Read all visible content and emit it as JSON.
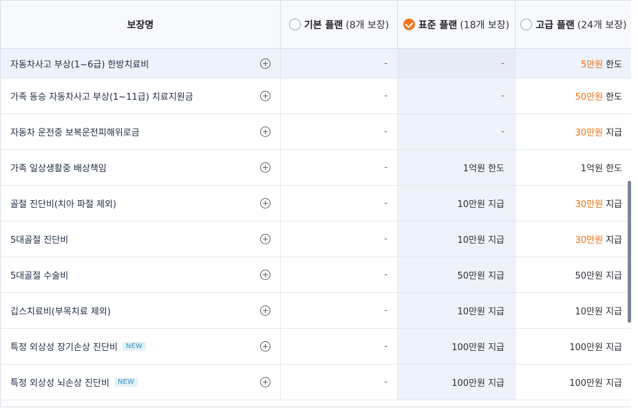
{
  "header": {
    "name_col": "보장명",
    "plans": [
      {
        "title": "기본 플랜",
        "count": "(8개 보장)",
        "selected": false
      },
      {
        "title": "표준 플랜",
        "count": "(18개 보장)",
        "selected": true
      },
      {
        "title": "고급 플랜",
        "count": "(24개 보장)",
        "selected": false
      }
    ]
  },
  "colors": {
    "accent": "#f2771f",
    "highlight_text": "#f06f12",
    "std_column_bg": "#eef2fa"
  },
  "rows": [
    {
      "name": "자동차사고 부상(1~6급) 한방치료비",
      "basic": "-",
      "std": "-",
      "prem_highlight": "5만원",
      "prem_rest": "한도",
      "prem_plain": ""
    },
    {
      "name": "가족 동승 자동차사고 부상(1~11급) 치료지원금",
      "basic": "-",
      "std": "-",
      "prem_highlight": "50만원",
      "prem_rest": "한도",
      "prem_plain": ""
    },
    {
      "name": "자동차 운전중 보복운전피해위로금",
      "basic": "-",
      "std": "-",
      "prem_highlight": "30만원",
      "prem_rest": "지급",
      "prem_plain": ""
    },
    {
      "name": "가족 일상생활중 배상책임",
      "basic": "-",
      "std": "1억원 한도",
      "prem_highlight": "",
      "prem_rest": "",
      "prem_plain": "1억원 한도"
    },
    {
      "name": "골절 진단비(치아 파절 제외)",
      "basic": "-",
      "std": "10만원 지급",
      "prem_highlight": "30만원",
      "prem_rest": "지급",
      "prem_plain": ""
    },
    {
      "name": "5대골절 진단비",
      "basic": "-",
      "std": "10만원 지급",
      "prem_highlight": "30만원",
      "prem_rest": "지급",
      "prem_plain": ""
    },
    {
      "name": "5대골절 수술비",
      "basic": "-",
      "std": "50만원 지급",
      "prem_highlight": "",
      "prem_rest": "",
      "prem_plain": "50만원 지급"
    },
    {
      "name": "깁스치료비(부목치료 제외)",
      "basic": "-",
      "std": "10만원 지급",
      "prem_highlight": "",
      "prem_rest": "",
      "prem_plain": "10만원 지급"
    },
    {
      "name": "특정 외상성 장기손상 진단비",
      "badge": "NEW",
      "basic": "-",
      "std": "100만원 지급",
      "prem_highlight": "",
      "prem_rest": "",
      "prem_plain": "100만원 지급"
    },
    {
      "name": "특정 외상성 뇌손상 진단비",
      "badge": "NEW",
      "basic": "-",
      "std": "100만원 지급",
      "prem_highlight": "",
      "prem_rest": "",
      "prem_plain": "100만원 지급"
    }
  ],
  "icons": {
    "expand": "plus-circle-icon",
    "selected_radio": "check-circle-icon",
    "radio": "radio-empty-icon"
  }
}
